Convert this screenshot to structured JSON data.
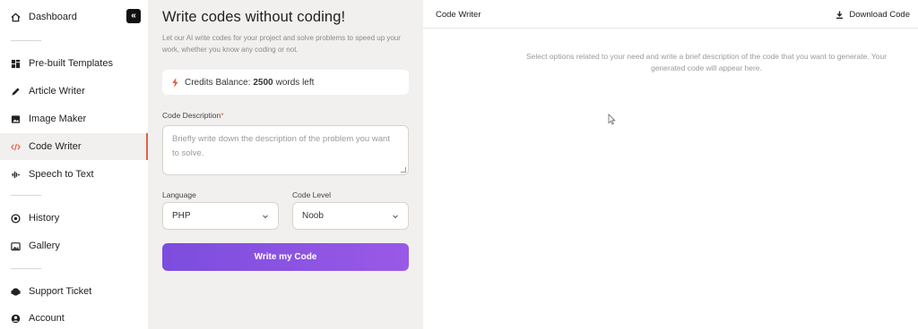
{
  "sidebar": {
    "collapse_label": "«",
    "items": [
      {
        "label": "Dashboard",
        "icon": "home-icon"
      },
      {
        "label": "Pre-built Templates",
        "icon": "templates-icon"
      },
      {
        "label": "Article Writer",
        "icon": "pen-icon"
      },
      {
        "label": "Image Maker",
        "icon": "image-icon"
      },
      {
        "label": "Code Writer",
        "icon": "code-icon",
        "active": true
      },
      {
        "label": "Speech to Text",
        "icon": "waveform-icon"
      },
      {
        "label": "History",
        "icon": "history-icon"
      },
      {
        "label": "Gallery",
        "icon": "gallery-icon"
      },
      {
        "label": "Support Ticket",
        "icon": "headset-icon"
      },
      {
        "label": "Account",
        "icon": "user-icon"
      }
    ]
  },
  "form": {
    "title": "Write codes without coding!",
    "description": "Let our AI write codes for your project and solve problems to speed up your work, whether you know any coding or not.",
    "credits": {
      "prefix": "Credits Balance:",
      "amount": "2500",
      "suffix": "words left"
    },
    "code_description": {
      "label": "Code Description",
      "required_mark": "*",
      "placeholder": "Briefly write down the description of the problem you want to solve."
    },
    "language": {
      "label": "Language",
      "value": "PHP"
    },
    "code_level": {
      "label": "Code Level",
      "value": "Noob"
    },
    "submit_label": "Write my Code"
  },
  "output": {
    "title": "Code Writer",
    "download_label": "Download Code",
    "placeholder": "Select options related to your need and write a brief description of the code that you want to generate. Your generated code will appear here."
  },
  "colors": {
    "accent": "#8a52e2",
    "active_marker": "#e0604a",
    "panel_bg": "#f1f0ee"
  }
}
